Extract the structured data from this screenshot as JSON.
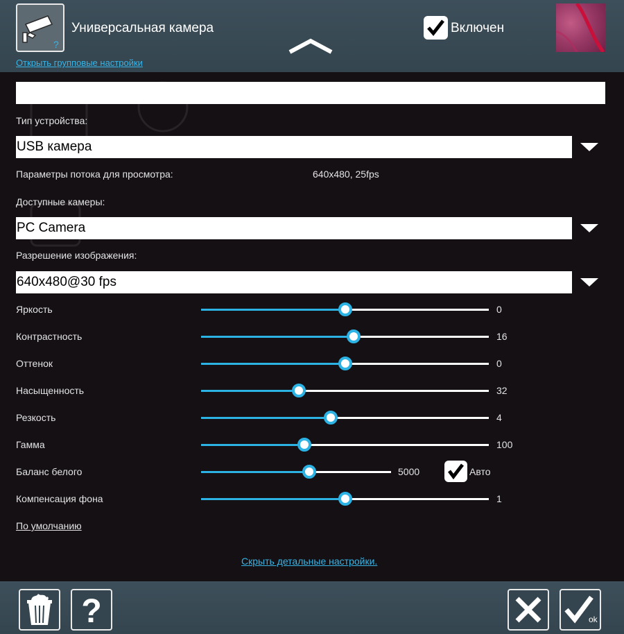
{
  "header": {
    "device_title": "Универсальная камера",
    "group_settings_link": "Открыть групповые настройки",
    "enabled_label": "Включен",
    "enabled_checked": true
  },
  "name_input": {
    "value": ""
  },
  "device_type": {
    "label": "Тип устройства:",
    "selected": "USB камера"
  },
  "stream": {
    "label": "Параметры потока для просмотра:",
    "value": "640x480, 25fps"
  },
  "cameras": {
    "label": "Доступные камеры:",
    "selected": "PC Camera"
  },
  "resolution": {
    "label": "Разрешение изображения:",
    "selected": "640x480@30 fps"
  },
  "sliders": [
    {
      "label": "Яркость",
      "value": "0",
      "fraction": 0.5
    },
    {
      "label": "Контрастность",
      "value": "16",
      "fraction": 0.53
    },
    {
      "label": "Оттенок",
      "value": "0",
      "fraction": 0.5
    },
    {
      "label": "Насыщенность",
      "value": "32",
      "fraction": 0.34
    },
    {
      "label": "Резкость",
      "value": "4",
      "fraction": 0.45
    },
    {
      "label": "Гамма",
      "value": "100",
      "fraction": 0.36
    },
    {
      "label": "Баланс белого",
      "value": "5000",
      "fraction": 0.57
    },
    {
      "label": "Компенсация фона",
      "value": "1",
      "fraction": 0.5
    }
  ],
  "white_balance_auto": {
    "label": "Авто",
    "checked": true
  },
  "defaults_link": "По умолчанию",
  "hide_details_link": "Скрыть детальные настройки.",
  "footer": {
    "ok_text": "ok"
  },
  "colors": {
    "accent": "#2db2e4",
    "link": "#38b4e6",
    "bar": "#3d4f5a",
    "background": "#141014"
  }
}
